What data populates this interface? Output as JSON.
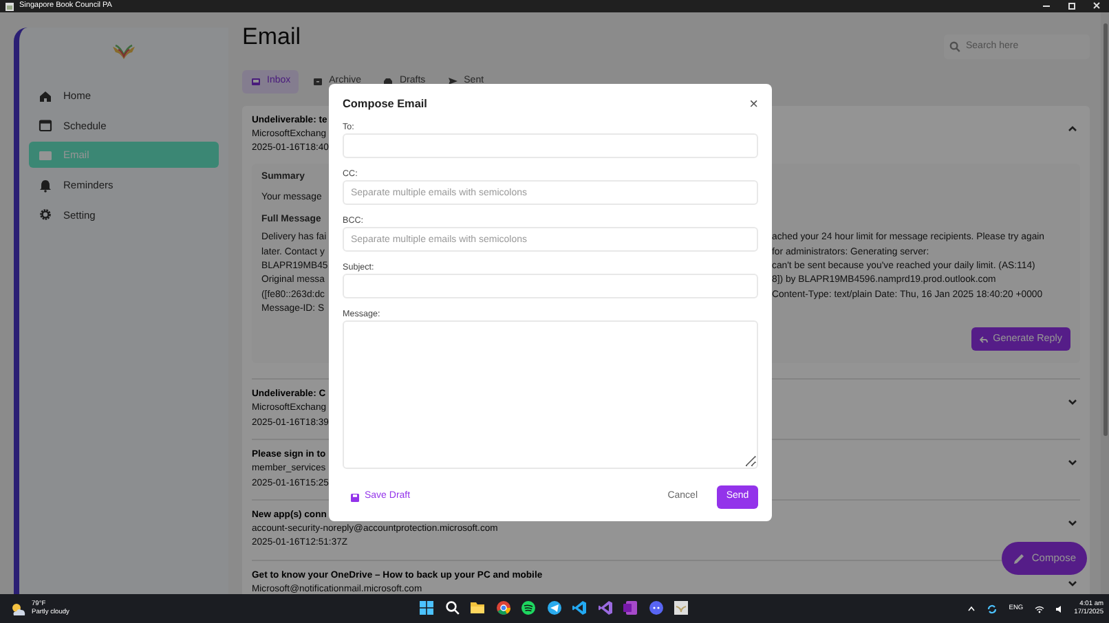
{
  "window": {
    "title": "Singapore Book Council PA"
  },
  "sidebar": {
    "items": [
      {
        "label": "Home",
        "selected": false
      },
      {
        "label": "Schedule",
        "selected": false
      },
      {
        "label": "Email",
        "selected": true
      },
      {
        "label": "Reminders",
        "selected": false
      },
      {
        "label": "Setting",
        "selected": false
      }
    ]
  },
  "page": {
    "title": "Email",
    "search": {
      "placeholder": "Search here"
    }
  },
  "tabs": [
    {
      "label": "Inbox",
      "selected": true
    },
    {
      "label": "Archive",
      "selected": false
    },
    {
      "label": "Drafts",
      "selected": false
    },
    {
      "label": "Sent",
      "selected": false
    }
  ],
  "emails": [
    {
      "subject": "Undeliverable: te",
      "sender": "MicrosoftExchang",
      "date": "2025-01-16T18:40",
      "expanded": true,
      "detail": {
        "summary_heading": "Summary",
        "summary": "Your message",
        "full_heading": "Full Message",
        "lines": [
          {
            "left": "Delivery has fai",
            "right": "ached your 24 hour limit for message recipients. Please try again"
          },
          {
            "left": "later. Contact y",
            "right": "for administrators: Generating server:"
          },
          {
            "left": "BLAPR19MB45",
            "right": "can't be sent because you've reached your daily limit. (AS:114)"
          },
          {
            "left": "Original messa",
            "right": "8]) by BLAPR19MB4596.namprd19.prod.outlook.com"
          },
          {
            "left": "([fe80::263d:dc",
            "right": "Content-Type: text/plain Date: Thu, 16 Jan 2025 18:40:20 +0000"
          },
          {
            "left": "Message-ID: S"
          }
        ],
        "reply_button": "Generate Reply"
      }
    },
    {
      "subject": "Undeliverable: C",
      "sender": "MicrosoftExchang",
      "date": "2025-01-16T18:39",
      "expanded": false
    },
    {
      "subject": "Please sign in to",
      "sender": "member_services",
      "date": "2025-01-16T15:25",
      "expanded": false
    },
    {
      "subject": "New app(s) conn",
      "sender": "account-security-noreply@accountprotection.microsoft.com",
      "date": "2025-01-16T12:51:37Z",
      "expanded": false
    },
    {
      "subject": "Get to know your OneDrive – How to back up your PC and mobile",
      "sender": "Microsoft@notificationmail.microsoft.com",
      "expanded": false
    }
  ],
  "compose_button": "Compose",
  "dialog": {
    "title": "Compose Email",
    "close": "×",
    "fields": [
      {
        "kind": "input",
        "label": "To:"
      },
      {
        "kind": "input",
        "label": "CC:",
        "placeholder": "Separate multiple emails with semicolons"
      },
      {
        "kind": "input",
        "label": "BCC:",
        "placeholder": "Separate multiple emails with semicolons"
      },
      {
        "kind": "input",
        "label": "Subject:"
      },
      {
        "kind": "textarea",
        "label": "Message:"
      }
    ],
    "save_draft": "Save Draft",
    "cancel": "Cancel",
    "send": "Send"
  },
  "taskbar": {
    "weather": {
      "temperature": "79°F",
      "condition": "Partly cloudy"
    },
    "language": "ENG",
    "time": "4:01 am",
    "date": "17/1/2025"
  }
}
